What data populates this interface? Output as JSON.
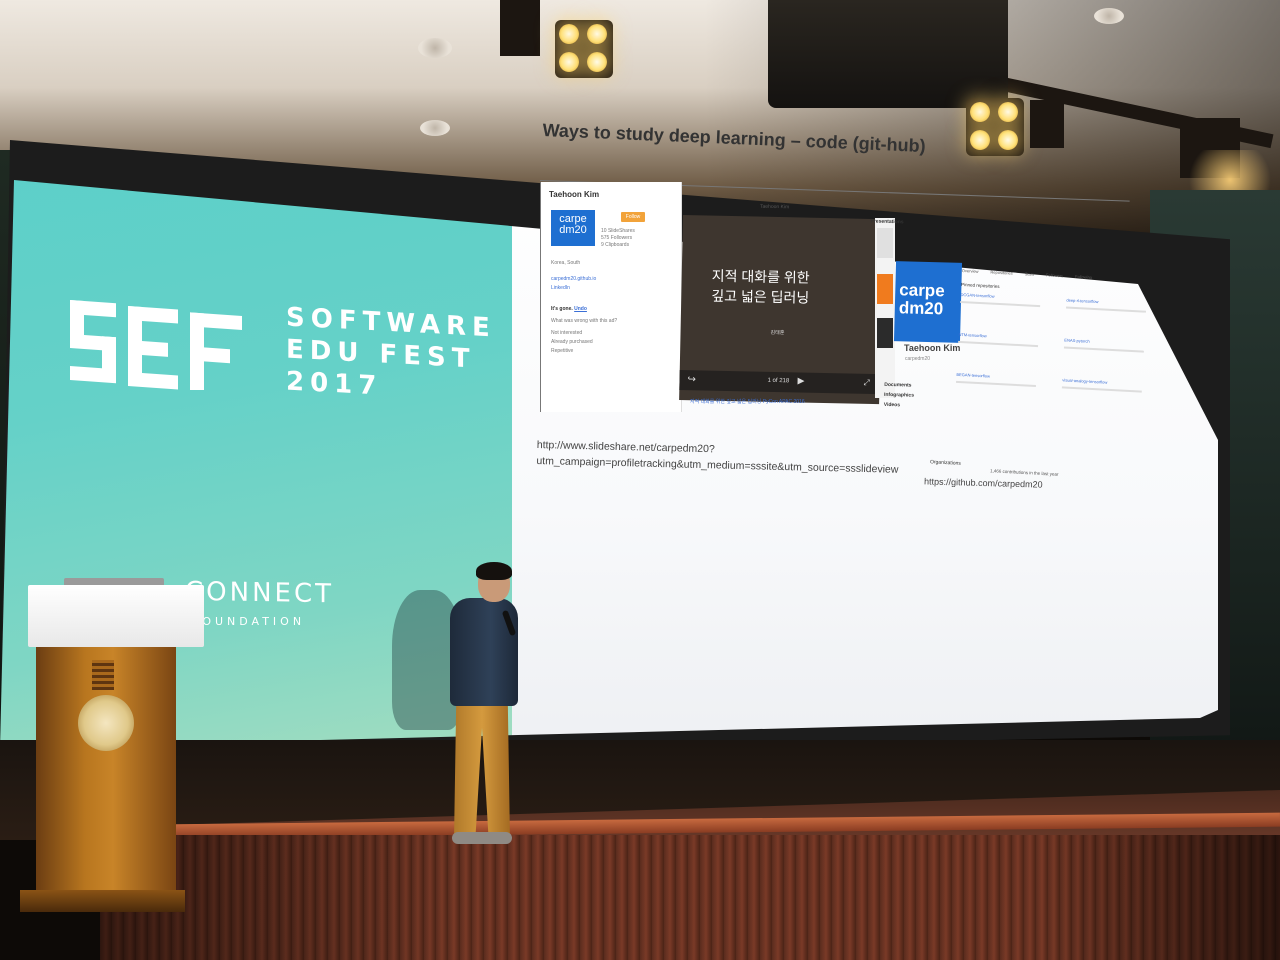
{
  "scene": {
    "description_tags": [
      "conference-stage",
      "presenter",
      "projector-screen",
      "lectern"
    ],
    "screen_left": {
      "brand_lines": [
        "SOFTWARE",
        "EDU FEST",
        "2017"
      ],
      "sponsor_name": "CONNECT",
      "sponsor_sub": "FOUNDATION"
    },
    "slide": {
      "title": "Ways to study deep learning – code (git-hub)",
      "profile": {
        "name": "Taehoon Kim",
        "avatar_text": "carpe dm20",
        "follow_label": "Follow",
        "stats": [
          "10 SlideShares",
          "575 Followers",
          "9 Clipboards"
        ],
        "location": "Korea, South",
        "site": "carpedm20.github.io",
        "linkedin": "LinkedIn",
        "ad_gone": "It's gone.",
        "ad_undo": "Undo",
        "ad_question": "What was wrong with this ad?",
        "ad_options": [
          "Not interested",
          "Already purchased",
          "Repetitive"
        ]
      },
      "video": {
        "header": "Taehoon Kim",
        "line1": "지적 대화를 위한",
        "line2": "깊고 넓은 딥러닝",
        "author": "김태훈",
        "page": "1 of 218",
        "caption": "지적 대화를 위한 깊고 넓은 딥러닝 PyCon APAC 2016"
      },
      "sidebar_labels": [
        "Presentations",
        "Documents",
        "Infographics",
        "Videos"
      ],
      "github": {
        "avatar_text": "carpe dm20",
        "name": "Taehoon Kim",
        "handle": "carpedm20",
        "tabs": [
          "Overview",
          "Repositories",
          "Stars",
          "Followers",
          "Following"
        ],
        "section": "Pinned repositories",
        "repos": [
          "DCGAN-tensorflow",
          "deep-rl-tensorflow",
          "NTM-tensorflow",
          "ENAS-pytorch",
          "BEGAN-tensorflow",
          "visual-analogy-tensorflow"
        ],
        "organizations": "Organizations",
        "contrib": "1,466 contributions in the last year",
        "url": "https://github.com/carpedm20"
      },
      "slideshare_url": "http://www.slideshare.net/carpedm20?utm_campaign=profiletracking&utm_medium=sssite&utm_source=ssslideview"
    }
  }
}
